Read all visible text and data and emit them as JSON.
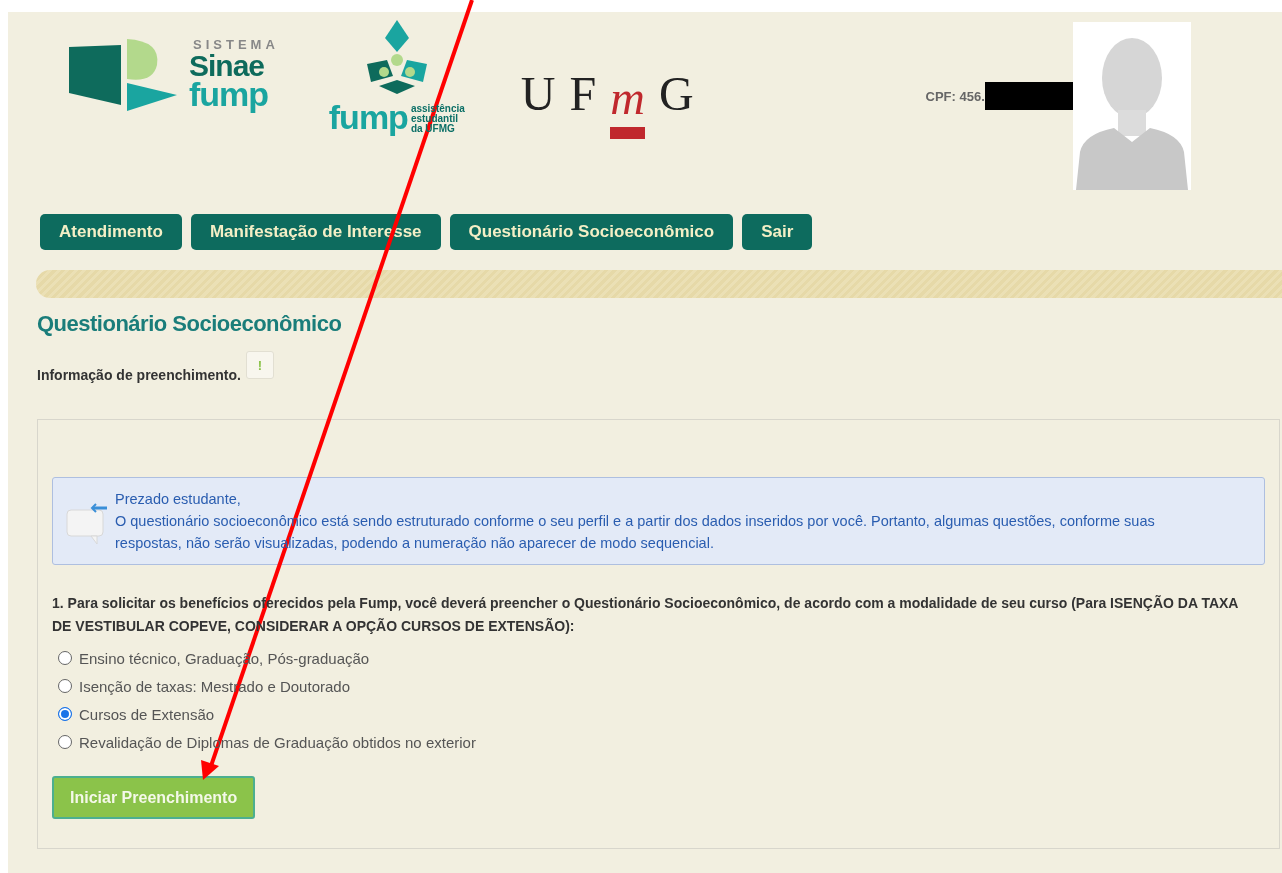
{
  "header": {
    "sinae_logo": {
      "overline": "SISTEMA",
      "line_1": "Sinae",
      "line_2": "fump"
    },
    "fump_logo": {
      "wordmark": "fump",
      "tagline": [
        "assistência",
        "estudantil",
        "da UFMG"
      ]
    },
    "ufmg_logo": {
      "letters": [
        "U",
        "F",
        "m",
        "G"
      ]
    },
    "cpf": "CPF: 456."
  },
  "nav": [
    {
      "label": "Atendimento",
      "selected": false
    },
    {
      "label": "Manifestação de Interesse",
      "selected": false
    },
    {
      "label": "Questionário Socioeconômico",
      "selected": false
    },
    {
      "label": "Sair",
      "selected": false
    }
  ],
  "page_title": "Questionário Socioeconômico",
  "info": {
    "label": "Informação de preenchimento.",
    "button": "!"
  },
  "alert": {
    "title": "Prezado estudante,",
    "text": "O questionário socioeconômico está sendo estruturado conforme o seu perfil e a partir dos dados inseridos por você. Portanto, algumas questões, conforme suas respostas, não serão visualizadas, podendo a numeração não aparecer de modo sequencial."
  },
  "question": {
    "text": "1. Para solicitar os benefícios oferecidos pela Fump, você deverá preencher o Questionário Socioeconômico, de acordo com a modalidade de seu curso (Para ISENÇÃO DA TAXA DE VESTIBULAR COPEVE, CONSIDERAR A OPÇÃO CURSOS DE EXTENSÃO):",
    "options": [
      {
        "label": "Ensino técnico, Graduação, Pós-graduação",
        "selected": false
      },
      {
        "label": "Isenção de taxas: Mestrado e Doutorado",
        "selected": false
      },
      {
        "label": "Cursos de Extensão",
        "selected": true
      },
      {
        "label": "Revalidação de Diplomas de Graduação obtidos no exterior",
        "selected": false
      }
    ]
  },
  "submit_button": "Iniciar Preenchimento"
}
